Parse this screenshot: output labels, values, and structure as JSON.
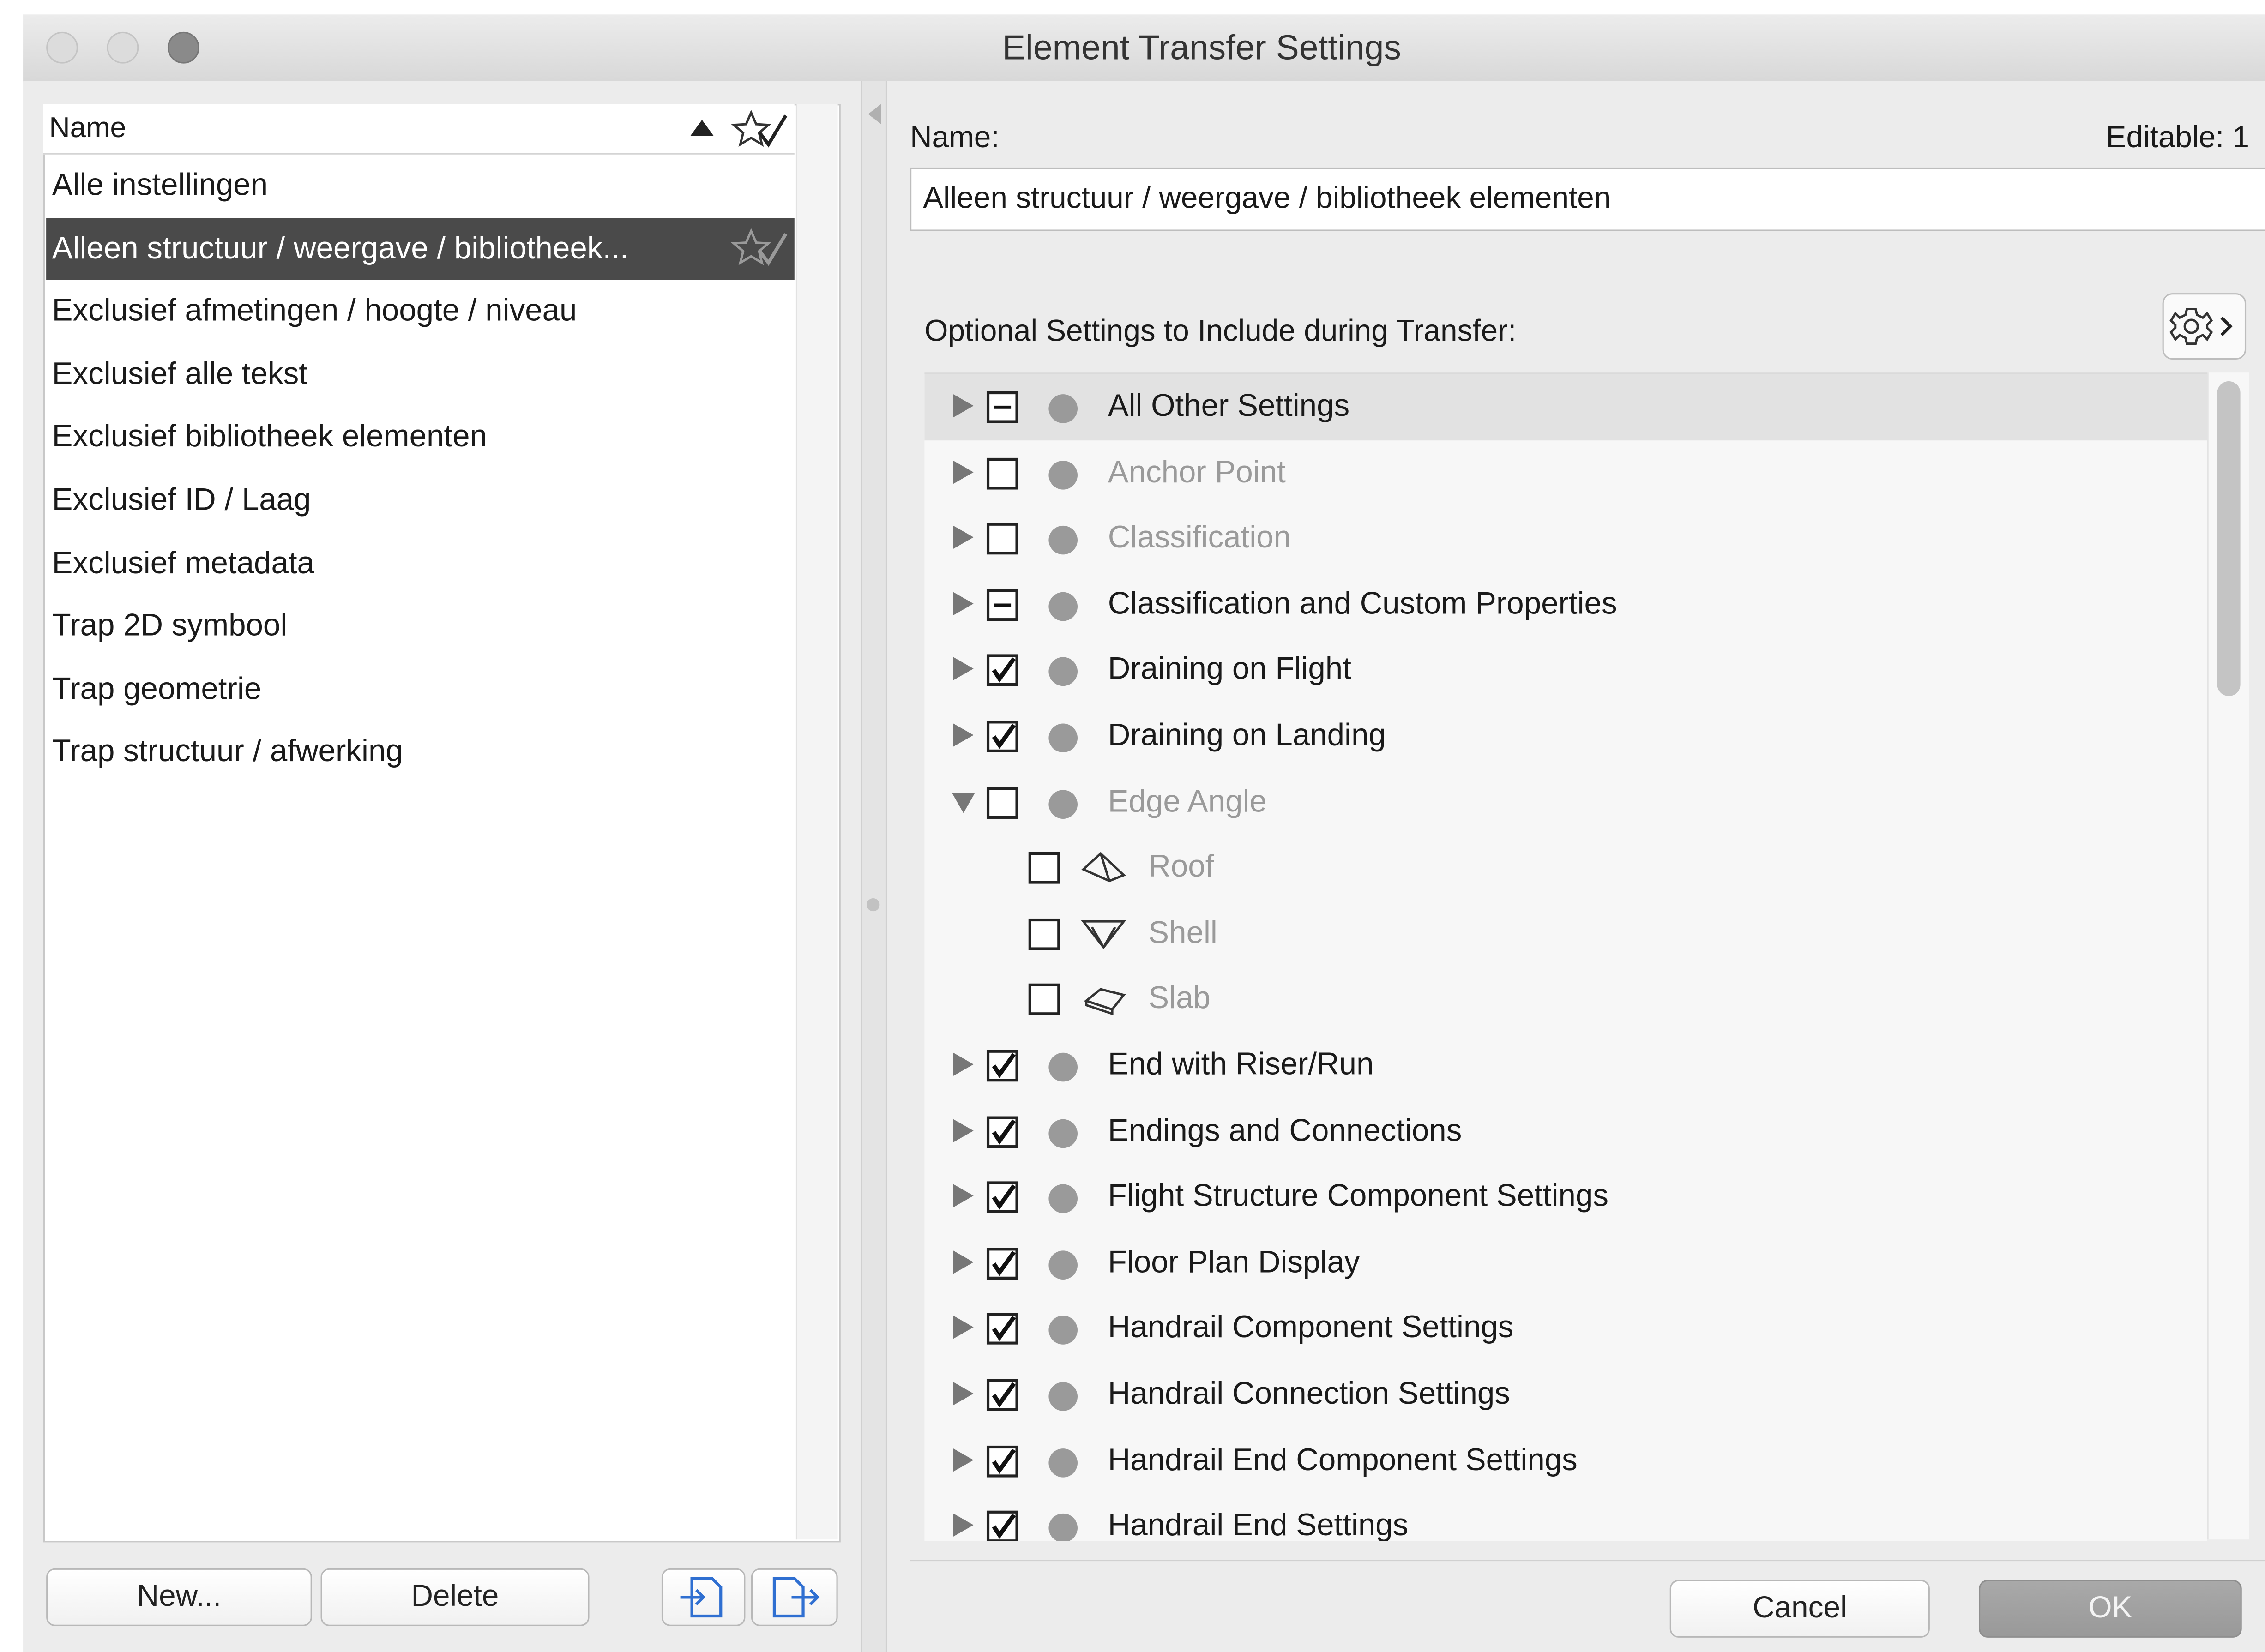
{
  "window": {
    "title": "Element Transfer Settings"
  },
  "left_panel": {
    "column_header": "Name",
    "presets": [
      {
        "label": "Alle instellingen",
        "selected": false
      },
      {
        "label": "Alleen structuur / weergave / bibliotheek...",
        "selected": true
      },
      {
        "label": "Exclusief afmetingen / hoogte / niveau",
        "selected": false
      },
      {
        "label": "Exclusief alle tekst",
        "selected": false
      },
      {
        "label": "Exclusief bibliotheek elementen",
        "selected": false
      },
      {
        "label": "Exclusief ID / Laag",
        "selected": false
      },
      {
        "label": "Exclusief metadata",
        "selected": false
      },
      {
        "label": "Trap 2D symbool",
        "selected": false
      },
      {
        "label": "Trap geometrie",
        "selected": false
      },
      {
        "label": "Trap structuur / afwerking",
        "selected": false
      }
    ],
    "new_label": "New...",
    "delete_label": "Delete"
  },
  "right_panel": {
    "name_label": "Name:",
    "editable_label": "Editable: 1",
    "name_value": "Alleen structuur / weergave / bibliotheek elementen",
    "optional_label": "Optional Settings to Include during Transfer:",
    "settings": [
      {
        "label": "All Other Settings",
        "state": "mixed",
        "expanded": false,
        "dim": false,
        "highlighted": true
      },
      {
        "label": "Anchor Point",
        "state": "unchecked",
        "expanded": false,
        "dim": true
      },
      {
        "label": "Classification",
        "state": "unchecked",
        "expanded": false,
        "dim": true
      },
      {
        "label": "Classification and Custom Properties",
        "state": "mixed",
        "expanded": false,
        "dim": false
      },
      {
        "label": "Draining on Flight",
        "state": "checked",
        "expanded": false,
        "dim": false
      },
      {
        "label": "Draining on Landing",
        "state": "checked",
        "expanded": false,
        "dim": false
      },
      {
        "label": "Edge Angle",
        "state": "unchecked",
        "expanded": true,
        "dim": true,
        "children": [
          {
            "label": "Roof",
            "icon": "roof-icon",
            "state": "unchecked"
          },
          {
            "label": "Shell",
            "icon": "shell-icon",
            "state": "unchecked"
          },
          {
            "label": "Slab",
            "icon": "slab-icon",
            "state": "unchecked"
          }
        ]
      },
      {
        "label": "End with Riser/Run",
        "state": "checked",
        "expanded": false,
        "dim": false
      },
      {
        "label": "Endings and Connections",
        "state": "checked",
        "expanded": false,
        "dim": false
      },
      {
        "label": "Flight Structure Component Settings",
        "state": "checked",
        "expanded": false,
        "dim": false
      },
      {
        "label": "Floor Plan Display",
        "state": "checked",
        "expanded": false,
        "dim": false
      },
      {
        "label": "Handrail Component Settings",
        "state": "checked",
        "expanded": false,
        "dim": false
      },
      {
        "label": "Handrail Connection Settings",
        "state": "checked",
        "expanded": false,
        "dim": false
      },
      {
        "label": "Handrail End Component Settings",
        "state": "checked",
        "expanded": false,
        "dim": false
      },
      {
        "label": "Handrail End Settings",
        "state": "checked",
        "expanded": false,
        "dim": false
      }
    ],
    "cancel_label": "Cancel",
    "ok_label": "OK"
  },
  "colors": {
    "selection": "#4a4a4a",
    "row_highlight": "#e2e2e2",
    "dimmed_text": "#9a9a9a",
    "status_dot": "#9a9a9a"
  }
}
